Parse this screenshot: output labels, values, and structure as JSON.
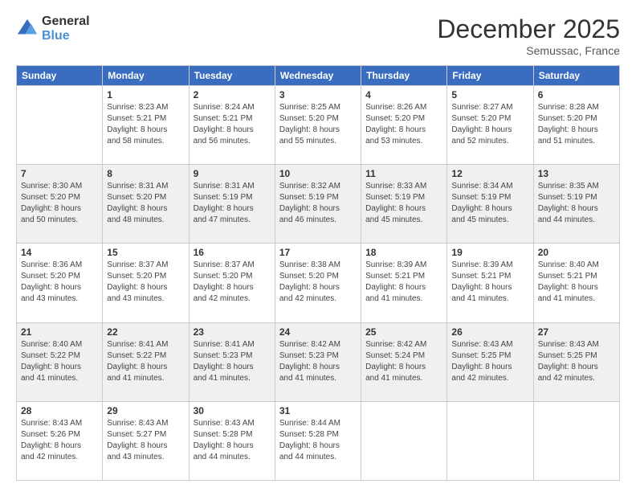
{
  "logo": {
    "general": "General",
    "blue": "Blue"
  },
  "header": {
    "month": "December 2025",
    "location": "Semussac, France"
  },
  "weekdays": [
    "Sunday",
    "Monday",
    "Tuesday",
    "Wednesday",
    "Thursday",
    "Friday",
    "Saturday"
  ],
  "weeks": [
    [
      {
        "day": "",
        "info": ""
      },
      {
        "day": "1",
        "info": "Sunrise: 8:23 AM\nSunset: 5:21 PM\nDaylight: 8 hours\nand 58 minutes."
      },
      {
        "day": "2",
        "info": "Sunrise: 8:24 AM\nSunset: 5:21 PM\nDaylight: 8 hours\nand 56 minutes."
      },
      {
        "day": "3",
        "info": "Sunrise: 8:25 AM\nSunset: 5:20 PM\nDaylight: 8 hours\nand 55 minutes."
      },
      {
        "day": "4",
        "info": "Sunrise: 8:26 AM\nSunset: 5:20 PM\nDaylight: 8 hours\nand 53 minutes."
      },
      {
        "day": "5",
        "info": "Sunrise: 8:27 AM\nSunset: 5:20 PM\nDaylight: 8 hours\nand 52 minutes."
      },
      {
        "day": "6",
        "info": "Sunrise: 8:28 AM\nSunset: 5:20 PM\nDaylight: 8 hours\nand 51 minutes."
      }
    ],
    [
      {
        "day": "7",
        "info": "Sunrise: 8:30 AM\nSunset: 5:20 PM\nDaylight: 8 hours\nand 50 minutes."
      },
      {
        "day": "8",
        "info": "Sunrise: 8:31 AM\nSunset: 5:20 PM\nDaylight: 8 hours\nand 48 minutes."
      },
      {
        "day": "9",
        "info": "Sunrise: 8:31 AM\nSunset: 5:19 PM\nDaylight: 8 hours\nand 47 minutes."
      },
      {
        "day": "10",
        "info": "Sunrise: 8:32 AM\nSunset: 5:19 PM\nDaylight: 8 hours\nand 46 minutes."
      },
      {
        "day": "11",
        "info": "Sunrise: 8:33 AM\nSunset: 5:19 PM\nDaylight: 8 hours\nand 45 minutes."
      },
      {
        "day": "12",
        "info": "Sunrise: 8:34 AM\nSunset: 5:19 PM\nDaylight: 8 hours\nand 45 minutes."
      },
      {
        "day": "13",
        "info": "Sunrise: 8:35 AM\nSunset: 5:19 PM\nDaylight: 8 hours\nand 44 minutes."
      }
    ],
    [
      {
        "day": "14",
        "info": "Sunrise: 8:36 AM\nSunset: 5:20 PM\nDaylight: 8 hours\nand 43 minutes."
      },
      {
        "day": "15",
        "info": "Sunrise: 8:37 AM\nSunset: 5:20 PM\nDaylight: 8 hours\nand 43 minutes."
      },
      {
        "day": "16",
        "info": "Sunrise: 8:37 AM\nSunset: 5:20 PM\nDaylight: 8 hours\nand 42 minutes."
      },
      {
        "day": "17",
        "info": "Sunrise: 8:38 AM\nSunset: 5:20 PM\nDaylight: 8 hours\nand 42 minutes."
      },
      {
        "day": "18",
        "info": "Sunrise: 8:39 AM\nSunset: 5:21 PM\nDaylight: 8 hours\nand 41 minutes."
      },
      {
        "day": "19",
        "info": "Sunrise: 8:39 AM\nSunset: 5:21 PM\nDaylight: 8 hours\nand 41 minutes."
      },
      {
        "day": "20",
        "info": "Sunrise: 8:40 AM\nSunset: 5:21 PM\nDaylight: 8 hours\nand 41 minutes."
      }
    ],
    [
      {
        "day": "21",
        "info": "Sunrise: 8:40 AM\nSunset: 5:22 PM\nDaylight: 8 hours\nand 41 minutes."
      },
      {
        "day": "22",
        "info": "Sunrise: 8:41 AM\nSunset: 5:22 PM\nDaylight: 8 hours\nand 41 minutes."
      },
      {
        "day": "23",
        "info": "Sunrise: 8:41 AM\nSunset: 5:23 PM\nDaylight: 8 hours\nand 41 minutes."
      },
      {
        "day": "24",
        "info": "Sunrise: 8:42 AM\nSunset: 5:23 PM\nDaylight: 8 hours\nand 41 minutes."
      },
      {
        "day": "25",
        "info": "Sunrise: 8:42 AM\nSunset: 5:24 PM\nDaylight: 8 hours\nand 41 minutes."
      },
      {
        "day": "26",
        "info": "Sunrise: 8:43 AM\nSunset: 5:25 PM\nDaylight: 8 hours\nand 42 minutes."
      },
      {
        "day": "27",
        "info": "Sunrise: 8:43 AM\nSunset: 5:25 PM\nDaylight: 8 hours\nand 42 minutes."
      }
    ],
    [
      {
        "day": "28",
        "info": "Sunrise: 8:43 AM\nSunset: 5:26 PM\nDaylight: 8 hours\nand 42 minutes."
      },
      {
        "day": "29",
        "info": "Sunrise: 8:43 AM\nSunset: 5:27 PM\nDaylight: 8 hours\nand 43 minutes."
      },
      {
        "day": "30",
        "info": "Sunrise: 8:43 AM\nSunset: 5:28 PM\nDaylight: 8 hours\nand 44 minutes."
      },
      {
        "day": "31",
        "info": "Sunrise: 8:44 AM\nSunset: 5:28 PM\nDaylight: 8 hours\nand 44 minutes."
      },
      {
        "day": "",
        "info": ""
      },
      {
        "day": "",
        "info": ""
      },
      {
        "day": "",
        "info": ""
      }
    ]
  ]
}
